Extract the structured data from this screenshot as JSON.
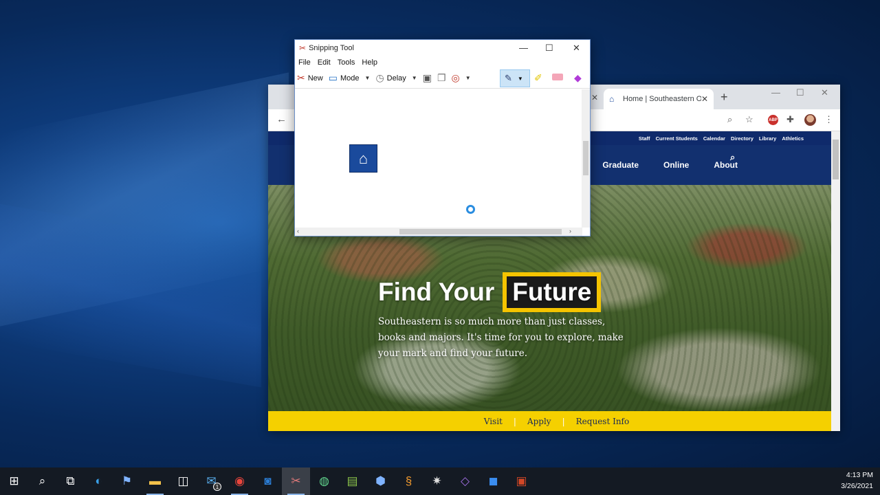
{
  "snipping_tool": {
    "title": "Snipping Tool",
    "menu": [
      "File",
      "Edit",
      "Tools",
      "Help"
    ],
    "toolbar": {
      "new_label": "New",
      "mode_label": "Mode",
      "delay_label": "Delay"
    }
  },
  "browser": {
    "tab_title": "Home | Southeastern O",
    "site": {
      "utility_links": [
        "Staff",
        "Current Students",
        "Calendar",
        "Directory",
        "Library",
        "Athletics"
      ],
      "main_nav": [
        "Graduate",
        "Online",
        "About"
      ],
      "headline_part1": "Find Your",
      "headline_part2": "Future",
      "subtext": "Southeastern is so much more than just classes, books and majors. It's time for you to explore, make your mark and find your future.",
      "cta": [
        "Visit",
        "Apply",
        "Request Info"
      ]
    }
  },
  "taskbar": {
    "icons": [
      "windows-start",
      "search",
      "task-view",
      "edge",
      "network-app",
      "file-explorer",
      "store",
      "mail",
      "chrome",
      "outlook",
      "snipping-tool",
      "maps-app",
      "notepad-app",
      "virtualbox",
      "sublime-text",
      "spider-app",
      "visual-studio",
      "zoom",
      "powerpoint"
    ],
    "mail_badge": "1",
    "time": "4:13 PM",
    "date": "3/26/2021"
  }
}
